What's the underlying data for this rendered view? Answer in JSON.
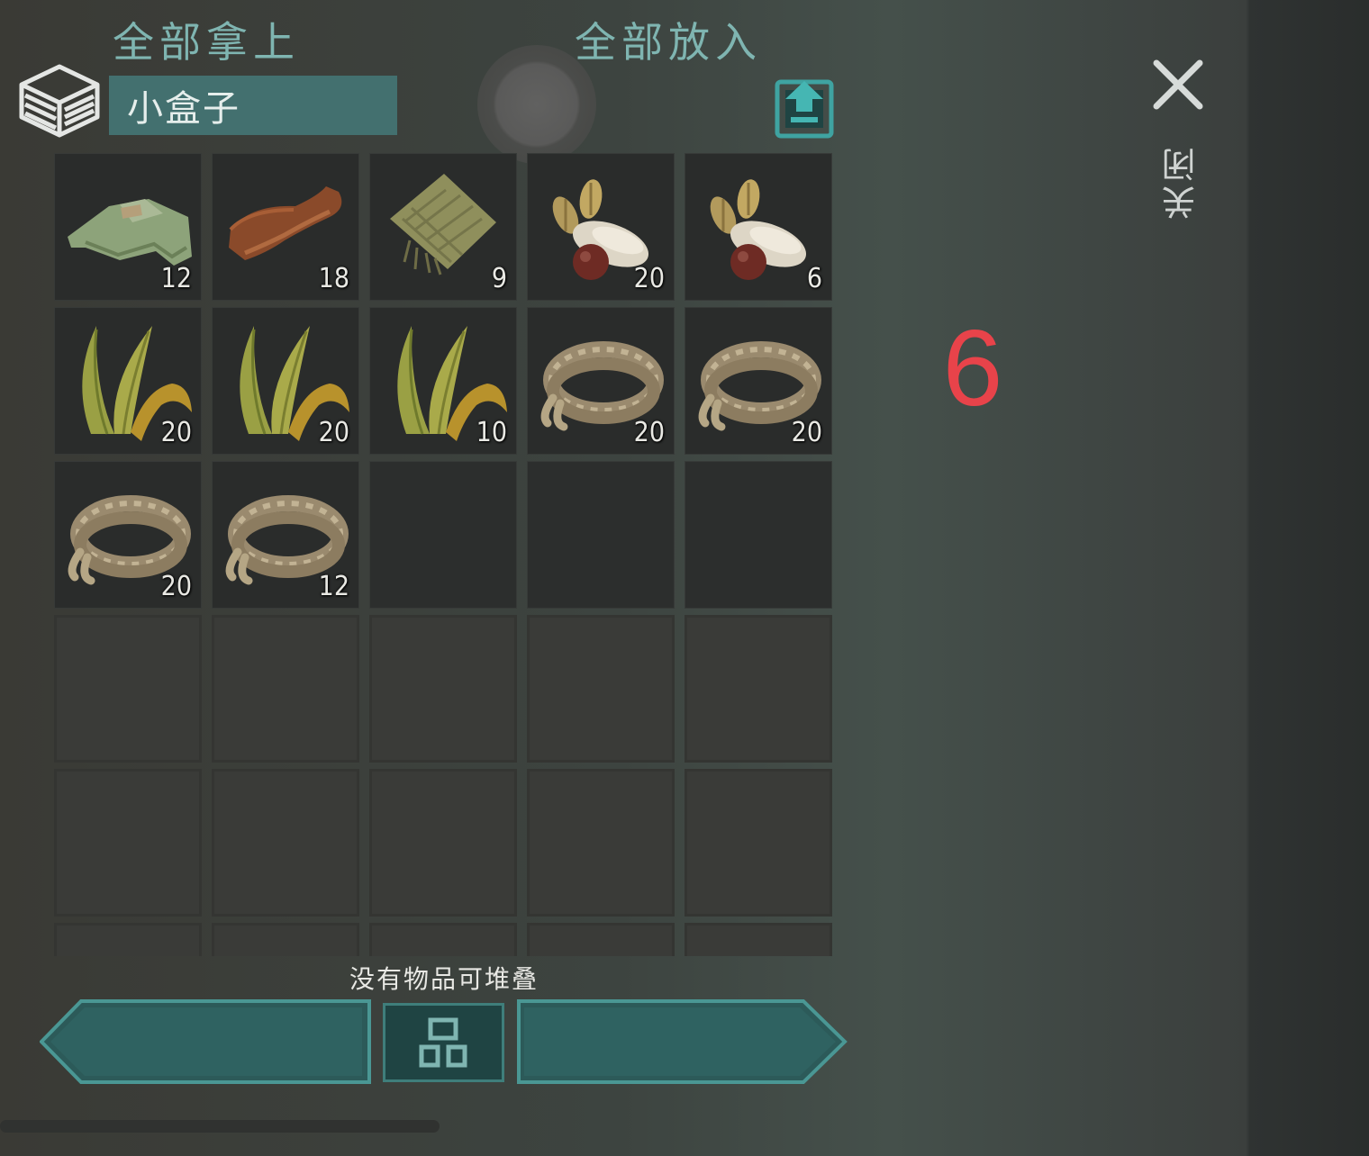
{
  "header": {
    "title": "小盒子",
    "box_icon": "stacked-box-icon",
    "export_icon": "export-upload-icon"
  },
  "inventory": {
    "columns": 5,
    "slots": [
      {
        "item": "cloth",
        "icon": "cloth-icon",
        "count": "12"
      },
      {
        "item": "leather",
        "icon": "leather-icon",
        "count": "18"
      },
      {
        "item": "burlap",
        "icon": "burlap-icon",
        "count": "9"
      },
      {
        "item": "seeds",
        "icon": "seeds-icon",
        "count": "20"
      },
      {
        "item": "seeds",
        "icon": "seeds-icon",
        "count": "6"
      },
      {
        "item": "plant-fiber",
        "icon": "plant-fiber-icon",
        "count": "20"
      },
      {
        "item": "plant-fiber",
        "icon": "plant-fiber-icon",
        "count": "20"
      },
      {
        "item": "plant-fiber",
        "icon": "plant-fiber-icon",
        "count": "10"
      },
      {
        "item": "rope",
        "icon": "rope-icon",
        "count": "20"
      },
      {
        "item": "rope",
        "icon": "rope-icon",
        "count": "20"
      },
      {
        "item": "rope",
        "icon": "rope-icon",
        "count": "20"
      },
      {
        "item": "rope",
        "icon": "rope-icon",
        "count": "12"
      },
      {
        "item": null
      },
      {
        "item": null
      },
      {
        "item": null
      },
      {
        "item": null,
        "style": "empty"
      },
      {
        "item": null,
        "style": "empty"
      },
      {
        "item": null,
        "style": "empty"
      },
      {
        "item": null,
        "style": "empty"
      },
      {
        "item": null,
        "style": "empty"
      },
      {
        "item": null,
        "style": "empty"
      },
      {
        "item": null,
        "style": "empty"
      },
      {
        "item": null,
        "style": "empty"
      },
      {
        "item": null,
        "style": "empty"
      },
      {
        "item": null,
        "style": "empty"
      },
      {
        "item": null,
        "style": "empty"
      },
      {
        "item": null,
        "style": "empty"
      },
      {
        "item": null,
        "style": "empty"
      },
      {
        "item": null,
        "style": "empty"
      },
      {
        "item": null,
        "style": "empty"
      }
    ]
  },
  "status_message": "没有物品可堆叠",
  "buttons": {
    "take_all": "全部拿上",
    "sort_icon": "grid-sort-icon",
    "put_all": "全部放入"
  },
  "side": {
    "close_label": "关闭",
    "close_icon": "close-icon",
    "marker_number": "6"
  },
  "colors": {
    "accent": "#43706f",
    "button_text": "#7fb5b1",
    "marker": "#e8434a"
  }
}
